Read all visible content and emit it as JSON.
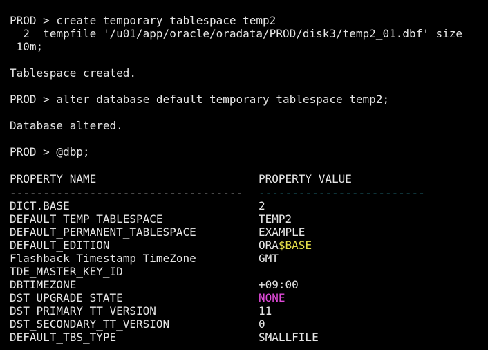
{
  "terminal": {
    "lines": [
      "PROD > create temporary tablespace temp2",
      "  2  tempfile '/u01/app/oracle/oradata/PROD/disk3/temp2_01.dbf' size",
      " 10m;",
      "",
      "Tablespace created.",
      "",
      "PROD > alter database default temporary tablespace temp2;",
      "",
      "Database altered.",
      "",
      "PROD > @dbp;"
    ],
    "header": {
      "name": "PROPERTY_NAME",
      "value": "PROPERTY_VALUE"
    },
    "separator_name": "-----------------------------------",
    "separator_value": "-------------------------",
    "rows": [
      {
        "name": "DICT.BASE",
        "value": "2"
      },
      {
        "name": "DEFAULT_TEMP_TABLESPACE",
        "value": "TEMP2"
      },
      {
        "name": "DEFAULT_PERMANENT_TABLESPACE",
        "value": "EXAMPLE"
      },
      {
        "name": "DEFAULT_EDITION",
        "value_prefix": "ORA",
        "value_highlight": "$BASE"
      },
      {
        "name": "Flashback Timestamp TimeZone",
        "value": "GMT"
      },
      {
        "name": "TDE_MASTER_KEY_ID",
        "value": ""
      },
      {
        "name": "DBTIMEZONE",
        "value": "+09:00"
      },
      {
        "name": "DST_UPGRADE_STATE",
        "value": "NONE"
      },
      {
        "name": "DST_PRIMARY_TT_VERSION",
        "value": "11"
      },
      {
        "name": "DST_SECONDARY_TT_VERSION",
        "value": "0"
      },
      {
        "name": "DEFAULT_TBS_TYPE",
        "value": "SMALLFILE"
      }
    ]
  },
  "colors": {
    "background": "#000000",
    "text": "#e6e6e6",
    "separator_value": "#2fa7b8",
    "highlight_yellow": "#e8e04a",
    "highlight_magenta": "#e04ad8"
  }
}
